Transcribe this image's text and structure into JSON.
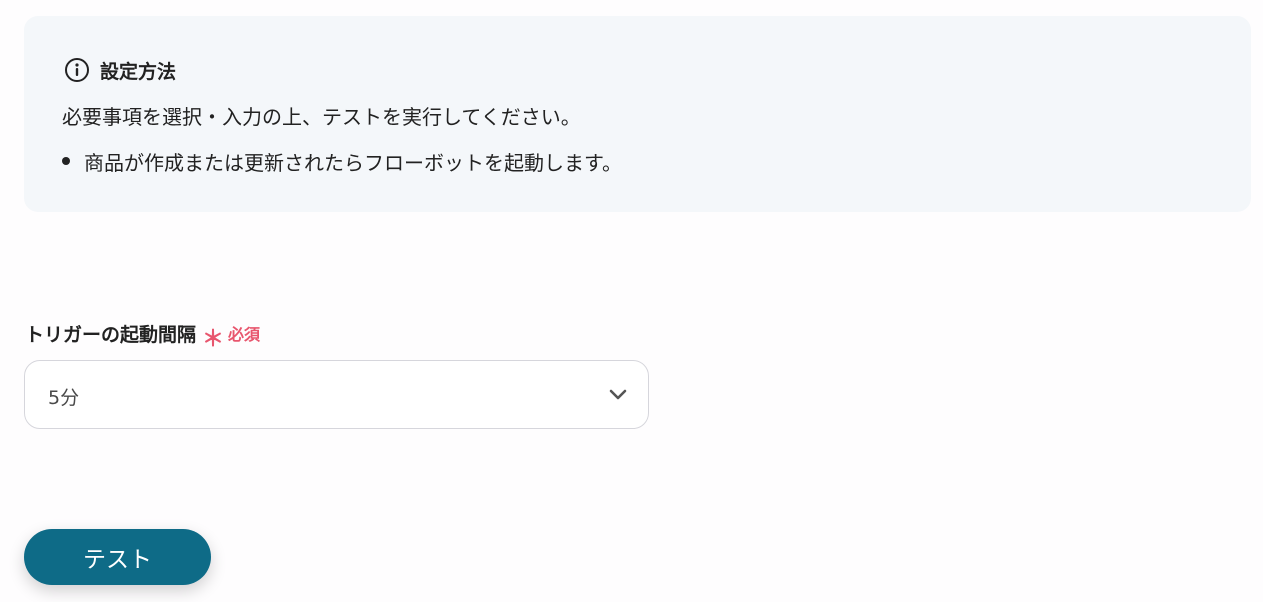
{
  "info_panel": {
    "icon": "info-circle-icon",
    "title": "設定方法",
    "description": "必要事項を選択・入力の上、テストを実行してください。",
    "items": [
      {
        "text": "商品が作成または更新されたらフローボットを起動します。"
      }
    ]
  },
  "trigger_interval": {
    "label": "トリガーの起動間隔",
    "required_mark": "＊",
    "required_text": "必須",
    "selected_value": "5分",
    "dropdown_icon": "chevron-down-icon"
  },
  "actions": {
    "test_button_label": "テスト"
  },
  "colors": {
    "panel_background": "#f4f7fa",
    "required": "#e8566e",
    "button": "#0e6b87",
    "text": "#222222"
  }
}
